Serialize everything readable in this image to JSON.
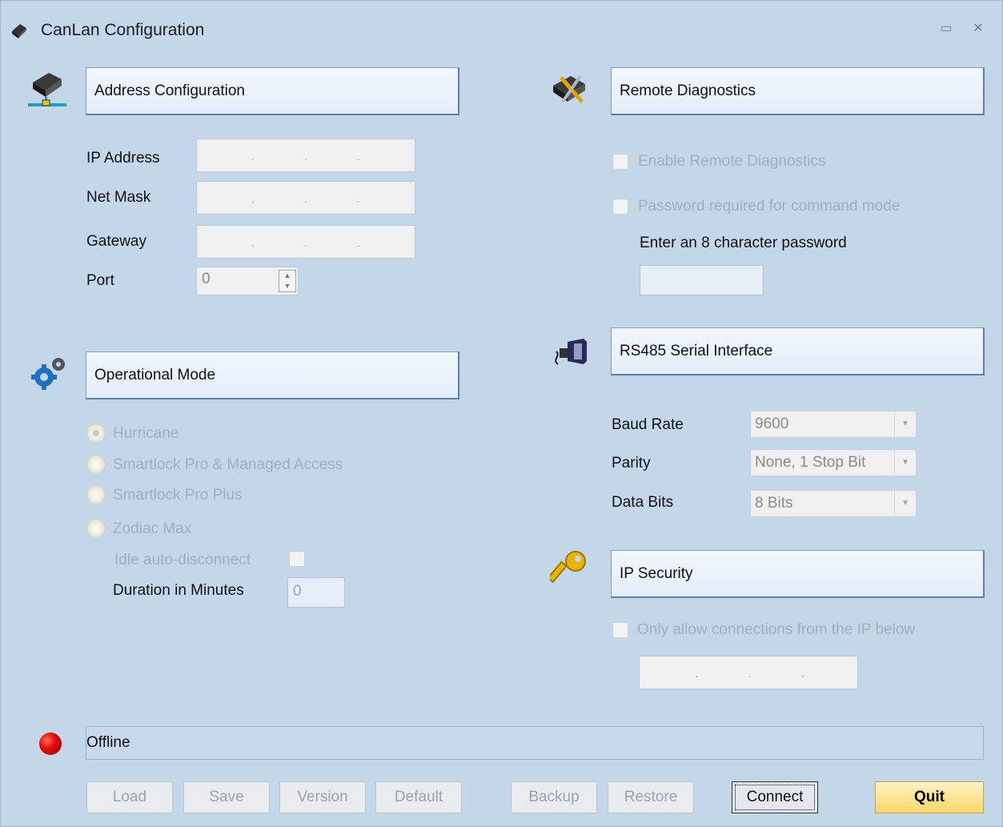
{
  "window": {
    "title": "CanLan Configuration"
  },
  "address": {
    "header": "Address Configuration",
    "ip_label": "IP Address",
    "mask_label": "Net Mask",
    "gateway_label": "Gateway",
    "port_label": "Port",
    "port_value": "0"
  },
  "mode": {
    "header": "Operational Mode",
    "options": [
      "Hurricane",
      "Smartlock Pro & Managed Access",
      "Smartlock Pro Plus",
      "Zodiac Max"
    ],
    "selected": "Hurricane",
    "idle_label": "Idle auto-disconnect",
    "duration_label": "Duration in Minutes",
    "duration_value": "0"
  },
  "remote": {
    "header": "Remote Diagnostics",
    "enable_label": "Enable Remote Diagnostics",
    "password_required_label": "Password required for command mode",
    "password_prompt": "Enter an 8 character password"
  },
  "serial": {
    "header": "RS485 Serial Interface",
    "baud_label": "Baud Rate",
    "baud_value": "9600",
    "parity_label": "Parity",
    "parity_value": "None, 1 Stop Bit",
    "databits_label": "Data Bits",
    "databits_value": "8 Bits"
  },
  "security": {
    "header": "IP Security",
    "only_allow_label": "Only allow connections from the  IP below"
  },
  "status": {
    "text": "Offline",
    "led_color": "#e40000"
  },
  "buttons": {
    "load": "Load",
    "save": "Save",
    "version": "Version",
    "default": "Default",
    "backup": "Backup",
    "restore": "Restore",
    "connect": "Connect",
    "quit": "Quit"
  },
  "colors": {
    "background": "#c4d6ea",
    "quit_button": "#f7d66a"
  }
}
